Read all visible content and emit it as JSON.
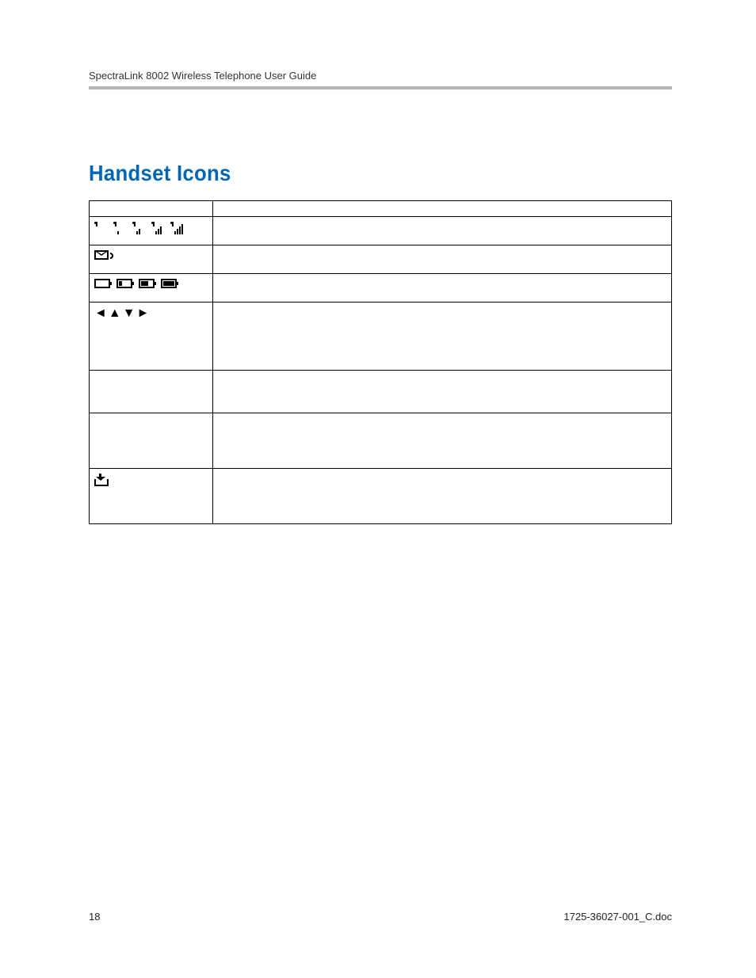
{
  "header": {
    "running_title": "SpectraLink 8002 Wireless Telephone User Guide"
  },
  "section": {
    "title": "Handset Icons"
  },
  "table": {
    "headers": {
      "col1": "",
      "col2": ""
    },
    "rows": [
      {
        "icon_name": "signal-strength-icons",
        "description": ""
      },
      {
        "icon_name": "voicemail-icon",
        "description": ""
      },
      {
        "icon_name": "battery-level-icons",
        "description": ""
      },
      {
        "icon_name": "nav-arrows-icons",
        "description": ""
      },
      {
        "icon_name": "",
        "description": ""
      },
      {
        "icon_name": "",
        "description": ""
      },
      {
        "icon_name": "download-icon",
        "description": ""
      }
    ]
  },
  "footer": {
    "page_number": "18",
    "doc_id": "1725-36027-001_C.doc"
  }
}
